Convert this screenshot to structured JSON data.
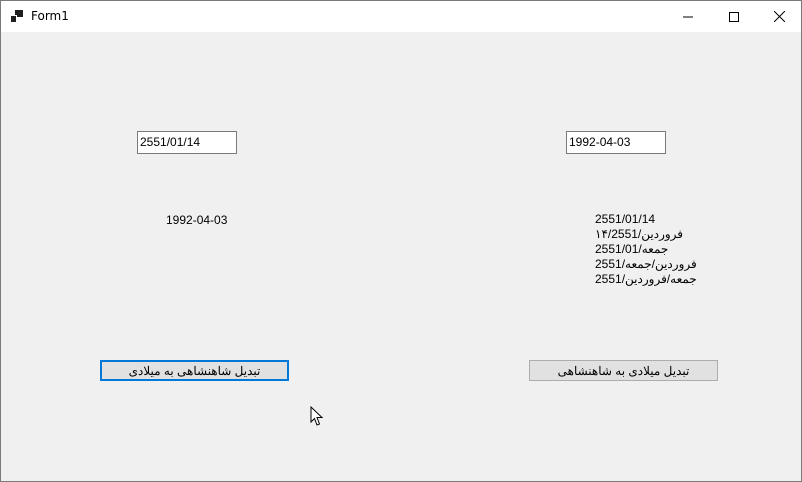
{
  "window": {
    "title": "Form1"
  },
  "left": {
    "input_value": "2551/01/14",
    "result": "1992-04-03",
    "button_label": "تبدیل شاهنشاهی به میلادی"
  },
  "right": {
    "input_value": "1992-04-03",
    "results": [
      "2551/01/14",
      "فروردین/۱۴/2551",
      "جمعه/2551/01",
      "فروردین/جمعه/2551",
      "جمعه/فروردین/2551"
    ],
    "button_label": "تبدیل میلادی به شاهنشاهی"
  },
  "colors": {
    "focus_border": "#0078d7",
    "button_face": "#e1e1e1",
    "form_background": "#f0f0f0"
  }
}
